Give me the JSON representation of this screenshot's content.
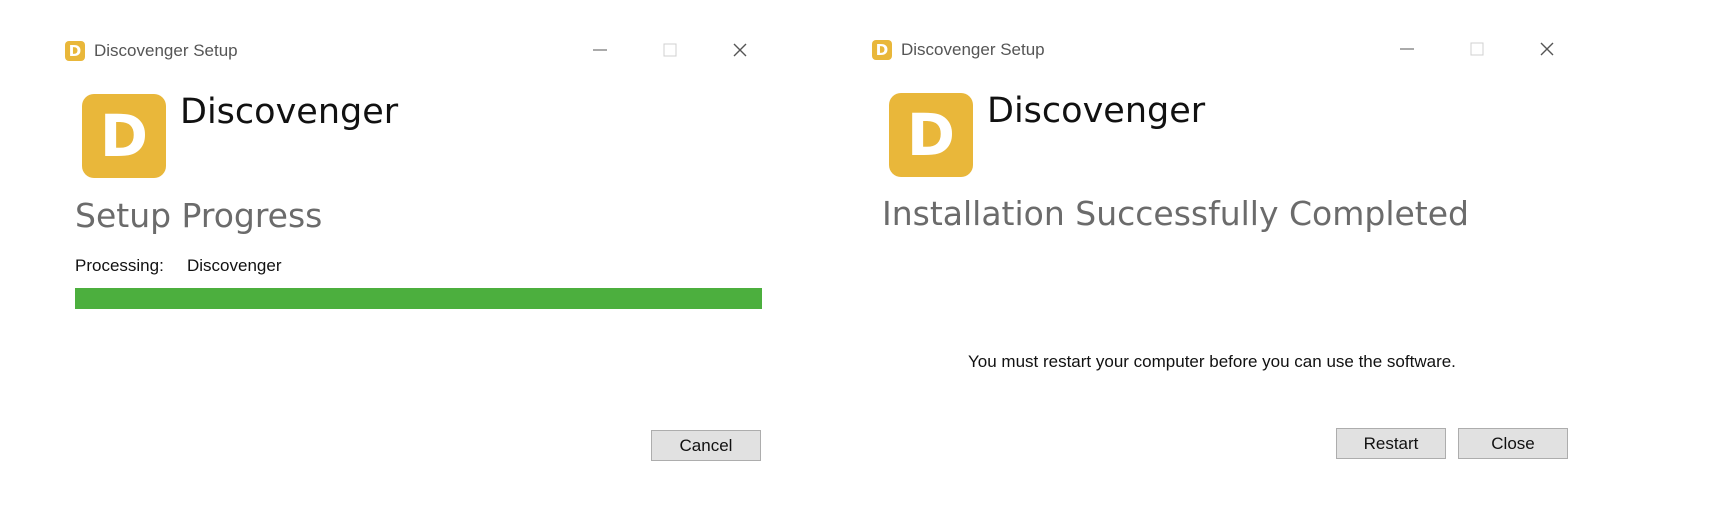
{
  "left_window": {
    "title": "Discovenger Setup",
    "title_icon_letter": "D",
    "logo_letter": "D",
    "app_name": "Discovenger",
    "heading": "Setup Progress",
    "processing_label": "Processing:",
    "processing_value": "Discovenger",
    "progress_percent": 100,
    "cancel_label": "Cancel"
  },
  "right_window": {
    "title": "Discovenger Setup",
    "title_icon_letter": "D",
    "logo_letter": "D",
    "app_name": "Discovenger",
    "heading": "Installation Successfully Completed",
    "message": "You must restart your computer before you can use the software.",
    "restart_label": "Restart",
    "close_label": "Close"
  },
  "icons": {
    "minimize": "minimize-icon",
    "maximize": "maximize-icon",
    "close": "close-icon"
  },
  "colors": {
    "brand": "#e9b73a",
    "progress": "#4caf3e",
    "button_bg": "#e1e1e1",
    "button_border": "#adadad"
  }
}
